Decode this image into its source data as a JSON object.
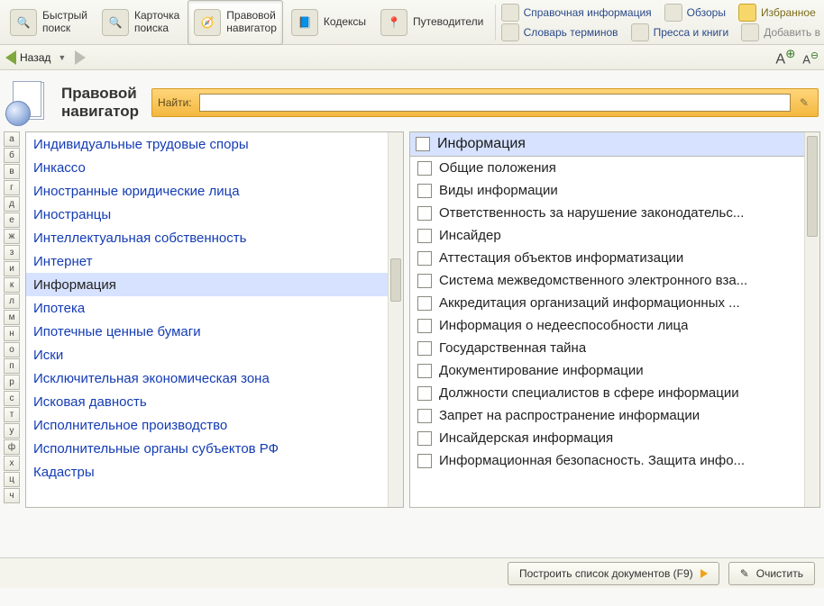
{
  "toolbar": {
    "quick_search": "Быстрый\nпоиск",
    "search_card": "Карточка\nпоиска",
    "navigator": "Правовой\nнавигатор",
    "codex": "Кодексы",
    "guides": "Путеводители",
    "ref_info": "Справочная информация",
    "reviews": "Обзоры",
    "glossary": "Словарь терминов",
    "press": "Пресса и книги",
    "favorites": "Избранное",
    "add_to": "Добавить в"
  },
  "nav": {
    "back": "Назад"
  },
  "header": {
    "title": "Правовой\nнавигатор",
    "search_label": "Найти:",
    "search_value": ""
  },
  "alphabet": [
    "а",
    "б",
    "в",
    "г",
    "д",
    "е",
    "ж",
    "з",
    "и",
    "к",
    "л",
    "м",
    "н",
    "о",
    "п",
    "р",
    "с",
    "т",
    "у",
    "ф",
    "х",
    "ц",
    "ч"
  ],
  "left_list": [
    "Индивидуальные трудовые споры",
    "Инкассо",
    "Иностранные юридические лица",
    "Иностранцы",
    "Интеллектуальная собственность",
    "Интернет",
    "Информация",
    "Ипотека",
    "Ипотечные ценные бумаги",
    "Иски",
    "Исключительная экономическая зона",
    "Исковая давность",
    "Исполнительное производство",
    "Исполнительные органы субъектов РФ",
    "Кадастры"
  ],
  "left_selected_index": 6,
  "right_header": "Информация",
  "right_list": [
    "Общие положения",
    "Виды информации",
    "Ответственность за нарушение законодательс...",
    "Инсайдер",
    "Аттестация объектов информатизации",
    "Система межведомственного электронного вза...",
    "Аккредитация организаций информационных ...",
    "Информация о недееспособности лица",
    "Государственная тайна",
    "Документирование информации",
    "Должности специалистов в сфере информации",
    "Запрет на распространение информации",
    "Инсайдерская информация",
    "Информационная безопасность. Защита инфо..."
  ],
  "footer": {
    "build": "Построить список документов (F9)",
    "clear": "Очистить"
  }
}
